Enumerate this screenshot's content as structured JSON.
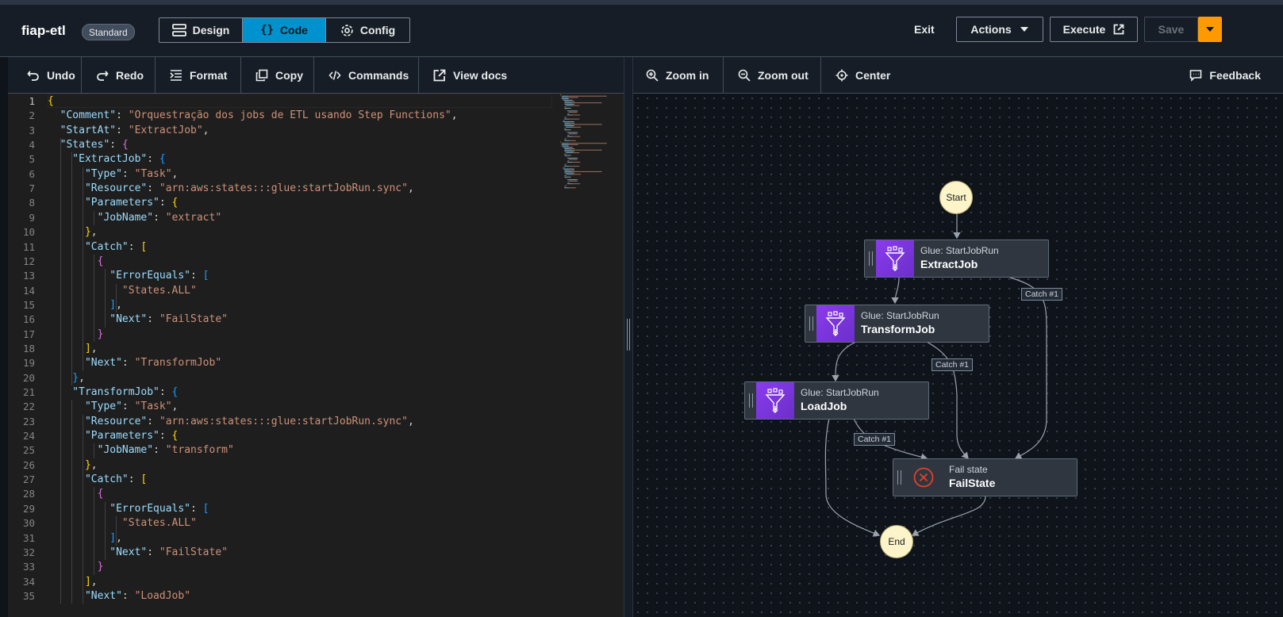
{
  "header": {
    "app_name": "fiap-etl",
    "badge": "Standard",
    "tabs": [
      {
        "label": "Design",
        "icon": "design-icon"
      },
      {
        "label": "Code",
        "icon": "braces-icon"
      },
      {
        "label": "Config",
        "icon": "gear-icon"
      }
    ],
    "active_tab": "Code",
    "exit_label": "Exit",
    "actions_label": "Actions",
    "execute_label": "Execute",
    "save_label": "Save"
  },
  "editor_toolbar": {
    "undo": "Undo",
    "redo": "Redo",
    "format": "Format",
    "copy": "Copy",
    "commands": "Commands",
    "view_docs": "View docs"
  },
  "canvas_toolbar": {
    "zoom_in": "Zoom in",
    "zoom_out": "Zoom out",
    "center": "Center",
    "feedback": "Feedback"
  },
  "code": {
    "active_line": 1,
    "line_numbers": [
      "1",
      "2",
      "3",
      "4",
      "5",
      "6",
      "7",
      "8",
      "9",
      "10",
      "11",
      "12",
      "13",
      "14",
      "15",
      "16",
      "17",
      "18",
      "19",
      "20",
      "21",
      "22",
      "23",
      "24",
      "25",
      "26",
      "27",
      "28",
      "29",
      "30",
      "31",
      "32",
      "33",
      "34",
      "35"
    ],
    "lines": [
      [
        [
          "b1",
          "{"
        ]
      ],
      [
        [
          "k",
          "  \"Comment\""
        ],
        [
          "p",
          ": "
        ],
        [
          "s",
          "\"Orquestração dos jobs de ETL usando Step Functions\""
        ],
        [
          "p",
          ","
        ]
      ],
      [
        [
          "k",
          "  \"StartAt\""
        ],
        [
          "p",
          ": "
        ],
        [
          "s",
          "\"ExtractJob\""
        ],
        [
          "p",
          ","
        ]
      ],
      [
        [
          "k",
          "  \"States\""
        ],
        [
          "p",
          ": "
        ],
        [
          "b2",
          "{"
        ]
      ],
      [
        [
          "k",
          "    \"ExtractJob\""
        ],
        [
          "p",
          ": "
        ],
        [
          "b3",
          "{"
        ]
      ],
      [
        [
          "k",
          "      \"Type\""
        ],
        [
          "p",
          ": "
        ],
        [
          "s",
          "\"Task\""
        ],
        [
          "p",
          ","
        ]
      ],
      [
        [
          "k",
          "      \"Resource\""
        ],
        [
          "p",
          ": "
        ],
        [
          "s",
          "\"arn:aws:states:::glue:startJobRun.sync\""
        ],
        [
          "p",
          ","
        ]
      ],
      [
        [
          "k",
          "      \"Parameters\""
        ],
        [
          "p",
          ": "
        ],
        [
          "b1",
          "{"
        ]
      ],
      [
        [
          "k",
          "        \"JobName\""
        ],
        [
          "p",
          ": "
        ],
        [
          "s",
          "\"extract\""
        ]
      ],
      [
        [
          "b1",
          "      }"
        ],
        [
          "p",
          ","
        ]
      ],
      [
        [
          "k",
          "      \"Catch\""
        ],
        [
          "p",
          ": "
        ],
        [
          "b1",
          "["
        ]
      ],
      [
        [
          "b2",
          "        {"
        ]
      ],
      [
        [
          "k",
          "          \"ErrorEquals\""
        ],
        [
          "p",
          ": "
        ],
        [
          "b3",
          "["
        ]
      ],
      [
        [
          "s",
          "            \"States.ALL\""
        ]
      ],
      [
        [
          "b3",
          "          ]"
        ],
        [
          "p",
          ","
        ]
      ],
      [
        [
          "k",
          "          \"Next\""
        ],
        [
          "p",
          ": "
        ],
        [
          "s",
          "\"FailState\""
        ]
      ],
      [
        [
          "b2",
          "        }"
        ]
      ],
      [
        [
          "b1",
          "      ]"
        ],
        [
          "p",
          ","
        ]
      ],
      [
        [
          "k",
          "      \"Next\""
        ],
        [
          "p",
          ": "
        ],
        [
          "s",
          "\"TransformJob\""
        ]
      ],
      [
        [
          "b3",
          "    }"
        ],
        [
          "p",
          ","
        ]
      ],
      [
        [
          "k",
          "    \"TransformJob\""
        ],
        [
          "p",
          ": "
        ],
        [
          "b3",
          "{"
        ]
      ],
      [
        [
          "k",
          "      \"Type\""
        ],
        [
          "p",
          ": "
        ],
        [
          "s",
          "\"Task\""
        ],
        [
          "p",
          ","
        ]
      ],
      [
        [
          "k",
          "      \"Resource\""
        ],
        [
          "p",
          ": "
        ],
        [
          "s",
          "\"arn:aws:states:::glue:startJobRun.sync\""
        ],
        [
          "p",
          ","
        ]
      ],
      [
        [
          "k",
          "      \"Parameters\""
        ],
        [
          "p",
          ": "
        ],
        [
          "b1",
          "{"
        ]
      ],
      [
        [
          "k",
          "        \"JobName\""
        ],
        [
          "p",
          ": "
        ],
        [
          "s",
          "\"transform\""
        ]
      ],
      [
        [
          "b1",
          "      }"
        ],
        [
          "p",
          ","
        ]
      ],
      [
        [
          "k",
          "      \"Catch\""
        ],
        [
          "p",
          ": "
        ],
        [
          "b1",
          "["
        ]
      ],
      [
        [
          "b2",
          "        {"
        ]
      ],
      [
        [
          "k",
          "          \"ErrorEquals\""
        ],
        [
          "p",
          ": "
        ],
        [
          "b3",
          "["
        ]
      ],
      [
        [
          "s",
          "            \"States.ALL\""
        ]
      ],
      [
        [
          "b3",
          "          ]"
        ],
        [
          "p",
          ","
        ]
      ],
      [
        [
          "k",
          "          \"Next\""
        ],
        [
          "p",
          ": "
        ],
        [
          "s",
          "\"FailState\""
        ]
      ],
      [
        [
          "b2",
          "        }"
        ]
      ],
      [
        [
          "b1",
          "      ]"
        ],
        [
          "p",
          ","
        ]
      ],
      [
        [
          "k",
          "      \"Next\""
        ],
        [
          "p",
          ": "
        ],
        [
          "s",
          "\"LoadJob\""
        ]
      ]
    ]
  },
  "graph": {
    "start_label": "Start",
    "end_label": "End",
    "nodes": {
      "extract": {
        "sub": "Glue: StartJobRun",
        "name": "ExtractJob"
      },
      "transform": {
        "sub": "Glue: StartJobRun",
        "name": "TransformJob"
      },
      "load": {
        "sub": "Glue: StartJobRun",
        "name": "LoadJob"
      },
      "fail": {
        "sub": "Fail state",
        "name": "FailState"
      }
    },
    "catch_labels": [
      "Catch #1",
      "Catch #1",
      "Catch #1"
    ],
    "colors": {
      "glue": "#7b3ae5",
      "fail": "#d13212",
      "terminal": "#fdf5c9",
      "accent": "#0092cf",
      "save_dropdown": "#ff9900"
    }
  }
}
